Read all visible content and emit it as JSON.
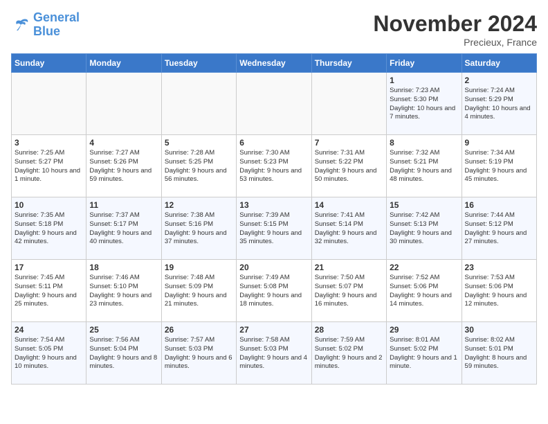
{
  "header": {
    "logo_line1": "General",
    "logo_line2": "Blue",
    "month": "November 2024",
    "location": "Precieux, France"
  },
  "weekdays": [
    "Sunday",
    "Monday",
    "Tuesday",
    "Wednesday",
    "Thursday",
    "Friday",
    "Saturday"
  ],
  "weeks": [
    [
      {
        "num": "",
        "text": ""
      },
      {
        "num": "",
        "text": ""
      },
      {
        "num": "",
        "text": ""
      },
      {
        "num": "",
        "text": ""
      },
      {
        "num": "",
        "text": ""
      },
      {
        "num": "1",
        "text": "Sunrise: 7:23 AM\nSunset: 5:30 PM\nDaylight: 10 hours and 7 minutes."
      },
      {
        "num": "2",
        "text": "Sunrise: 7:24 AM\nSunset: 5:29 PM\nDaylight: 10 hours and 4 minutes."
      }
    ],
    [
      {
        "num": "3",
        "text": "Sunrise: 7:25 AM\nSunset: 5:27 PM\nDaylight: 10 hours and 1 minute."
      },
      {
        "num": "4",
        "text": "Sunrise: 7:27 AM\nSunset: 5:26 PM\nDaylight: 9 hours and 59 minutes."
      },
      {
        "num": "5",
        "text": "Sunrise: 7:28 AM\nSunset: 5:25 PM\nDaylight: 9 hours and 56 minutes."
      },
      {
        "num": "6",
        "text": "Sunrise: 7:30 AM\nSunset: 5:23 PM\nDaylight: 9 hours and 53 minutes."
      },
      {
        "num": "7",
        "text": "Sunrise: 7:31 AM\nSunset: 5:22 PM\nDaylight: 9 hours and 50 minutes."
      },
      {
        "num": "8",
        "text": "Sunrise: 7:32 AM\nSunset: 5:21 PM\nDaylight: 9 hours and 48 minutes."
      },
      {
        "num": "9",
        "text": "Sunrise: 7:34 AM\nSunset: 5:19 PM\nDaylight: 9 hours and 45 minutes."
      }
    ],
    [
      {
        "num": "10",
        "text": "Sunrise: 7:35 AM\nSunset: 5:18 PM\nDaylight: 9 hours and 42 minutes."
      },
      {
        "num": "11",
        "text": "Sunrise: 7:37 AM\nSunset: 5:17 PM\nDaylight: 9 hours and 40 minutes."
      },
      {
        "num": "12",
        "text": "Sunrise: 7:38 AM\nSunset: 5:16 PM\nDaylight: 9 hours and 37 minutes."
      },
      {
        "num": "13",
        "text": "Sunrise: 7:39 AM\nSunset: 5:15 PM\nDaylight: 9 hours and 35 minutes."
      },
      {
        "num": "14",
        "text": "Sunrise: 7:41 AM\nSunset: 5:14 PM\nDaylight: 9 hours and 32 minutes."
      },
      {
        "num": "15",
        "text": "Sunrise: 7:42 AM\nSunset: 5:13 PM\nDaylight: 9 hours and 30 minutes."
      },
      {
        "num": "16",
        "text": "Sunrise: 7:44 AM\nSunset: 5:12 PM\nDaylight: 9 hours and 27 minutes."
      }
    ],
    [
      {
        "num": "17",
        "text": "Sunrise: 7:45 AM\nSunset: 5:11 PM\nDaylight: 9 hours and 25 minutes."
      },
      {
        "num": "18",
        "text": "Sunrise: 7:46 AM\nSunset: 5:10 PM\nDaylight: 9 hours and 23 minutes."
      },
      {
        "num": "19",
        "text": "Sunrise: 7:48 AM\nSunset: 5:09 PM\nDaylight: 9 hours and 21 minutes."
      },
      {
        "num": "20",
        "text": "Sunrise: 7:49 AM\nSunset: 5:08 PM\nDaylight: 9 hours and 18 minutes."
      },
      {
        "num": "21",
        "text": "Sunrise: 7:50 AM\nSunset: 5:07 PM\nDaylight: 9 hours and 16 minutes."
      },
      {
        "num": "22",
        "text": "Sunrise: 7:52 AM\nSunset: 5:06 PM\nDaylight: 9 hours and 14 minutes."
      },
      {
        "num": "23",
        "text": "Sunrise: 7:53 AM\nSunset: 5:06 PM\nDaylight: 9 hours and 12 minutes."
      }
    ],
    [
      {
        "num": "24",
        "text": "Sunrise: 7:54 AM\nSunset: 5:05 PM\nDaylight: 9 hours and 10 minutes."
      },
      {
        "num": "25",
        "text": "Sunrise: 7:56 AM\nSunset: 5:04 PM\nDaylight: 9 hours and 8 minutes."
      },
      {
        "num": "26",
        "text": "Sunrise: 7:57 AM\nSunset: 5:03 PM\nDaylight: 9 hours and 6 minutes."
      },
      {
        "num": "27",
        "text": "Sunrise: 7:58 AM\nSunset: 5:03 PM\nDaylight: 9 hours and 4 minutes."
      },
      {
        "num": "28",
        "text": "Sunrise: 7:59 AM\nSunset: 5:02 PM\nDaylight: 9 hours and 2 minutes."
      },
      {
        "num": "29",
        "text": "Sunrise: 8:01 AM\nSunset: 5:02 PM\nDaylight: 9 hours and 1 minute."
      },
      {
        "num": "30",
        "text": "Sunrise: 8:02 AM\nSunset: 5:01 PM\nDaylight: 8 hours and 59 minutes."
      }
    ]
  ]
}
